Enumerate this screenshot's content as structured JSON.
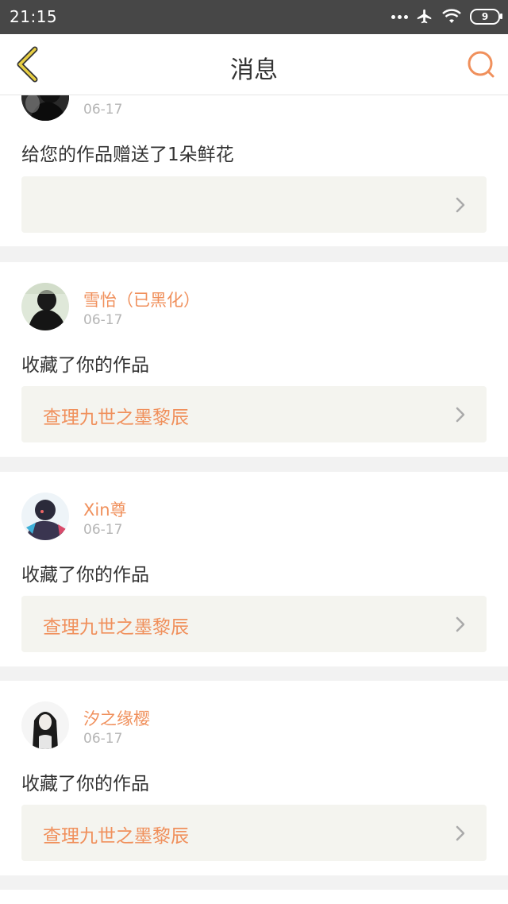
{
  "status_bar": {
    "time": "21:15",
    "battery": "9",
    "icons": [
      "more-dots-icon",
      "airplane-icon",
      "wifi-icon",
      "battery-icon"
    ]
  },
  "header": {
    "title": "消息",
    "back_icon": "back-chevron-icon",
    "search_icon": "search-icon"
  },
  "colors": {
    "accent": "#f0905c",
    "back_icon_color": "#e8cf43",
    "text": "#333333",
    "date": "#b5b5b5",
    "work_box_bg": "#f4f4ef",
    "divider_bg": "#f2f2f2"
  },
  "messages": [
    {
      "user": "",
      "date": "06-17",
      "text": "给您的作品赠送了1朵鲜花",
      "work_title": ""
    },
    {
      "user": "雪怡（已黑化）",
      "date": "06-17",
      "text": "收藏了你的作品",
      "work_title": "查理九世之墨黎辰"
    },
    {
      "user": "Xin尊",
      "date": "06-17",
      "text": "收藏了你的作品",
      "work_title": "查理九世之墨黎辰"
    },
    {
      "user": "汐之缘樱",
      "date": "06-17",
      "text": "收藏了你的作品",
      "work_title": "查理九世之墨黎辰"
    }
  ]
}
